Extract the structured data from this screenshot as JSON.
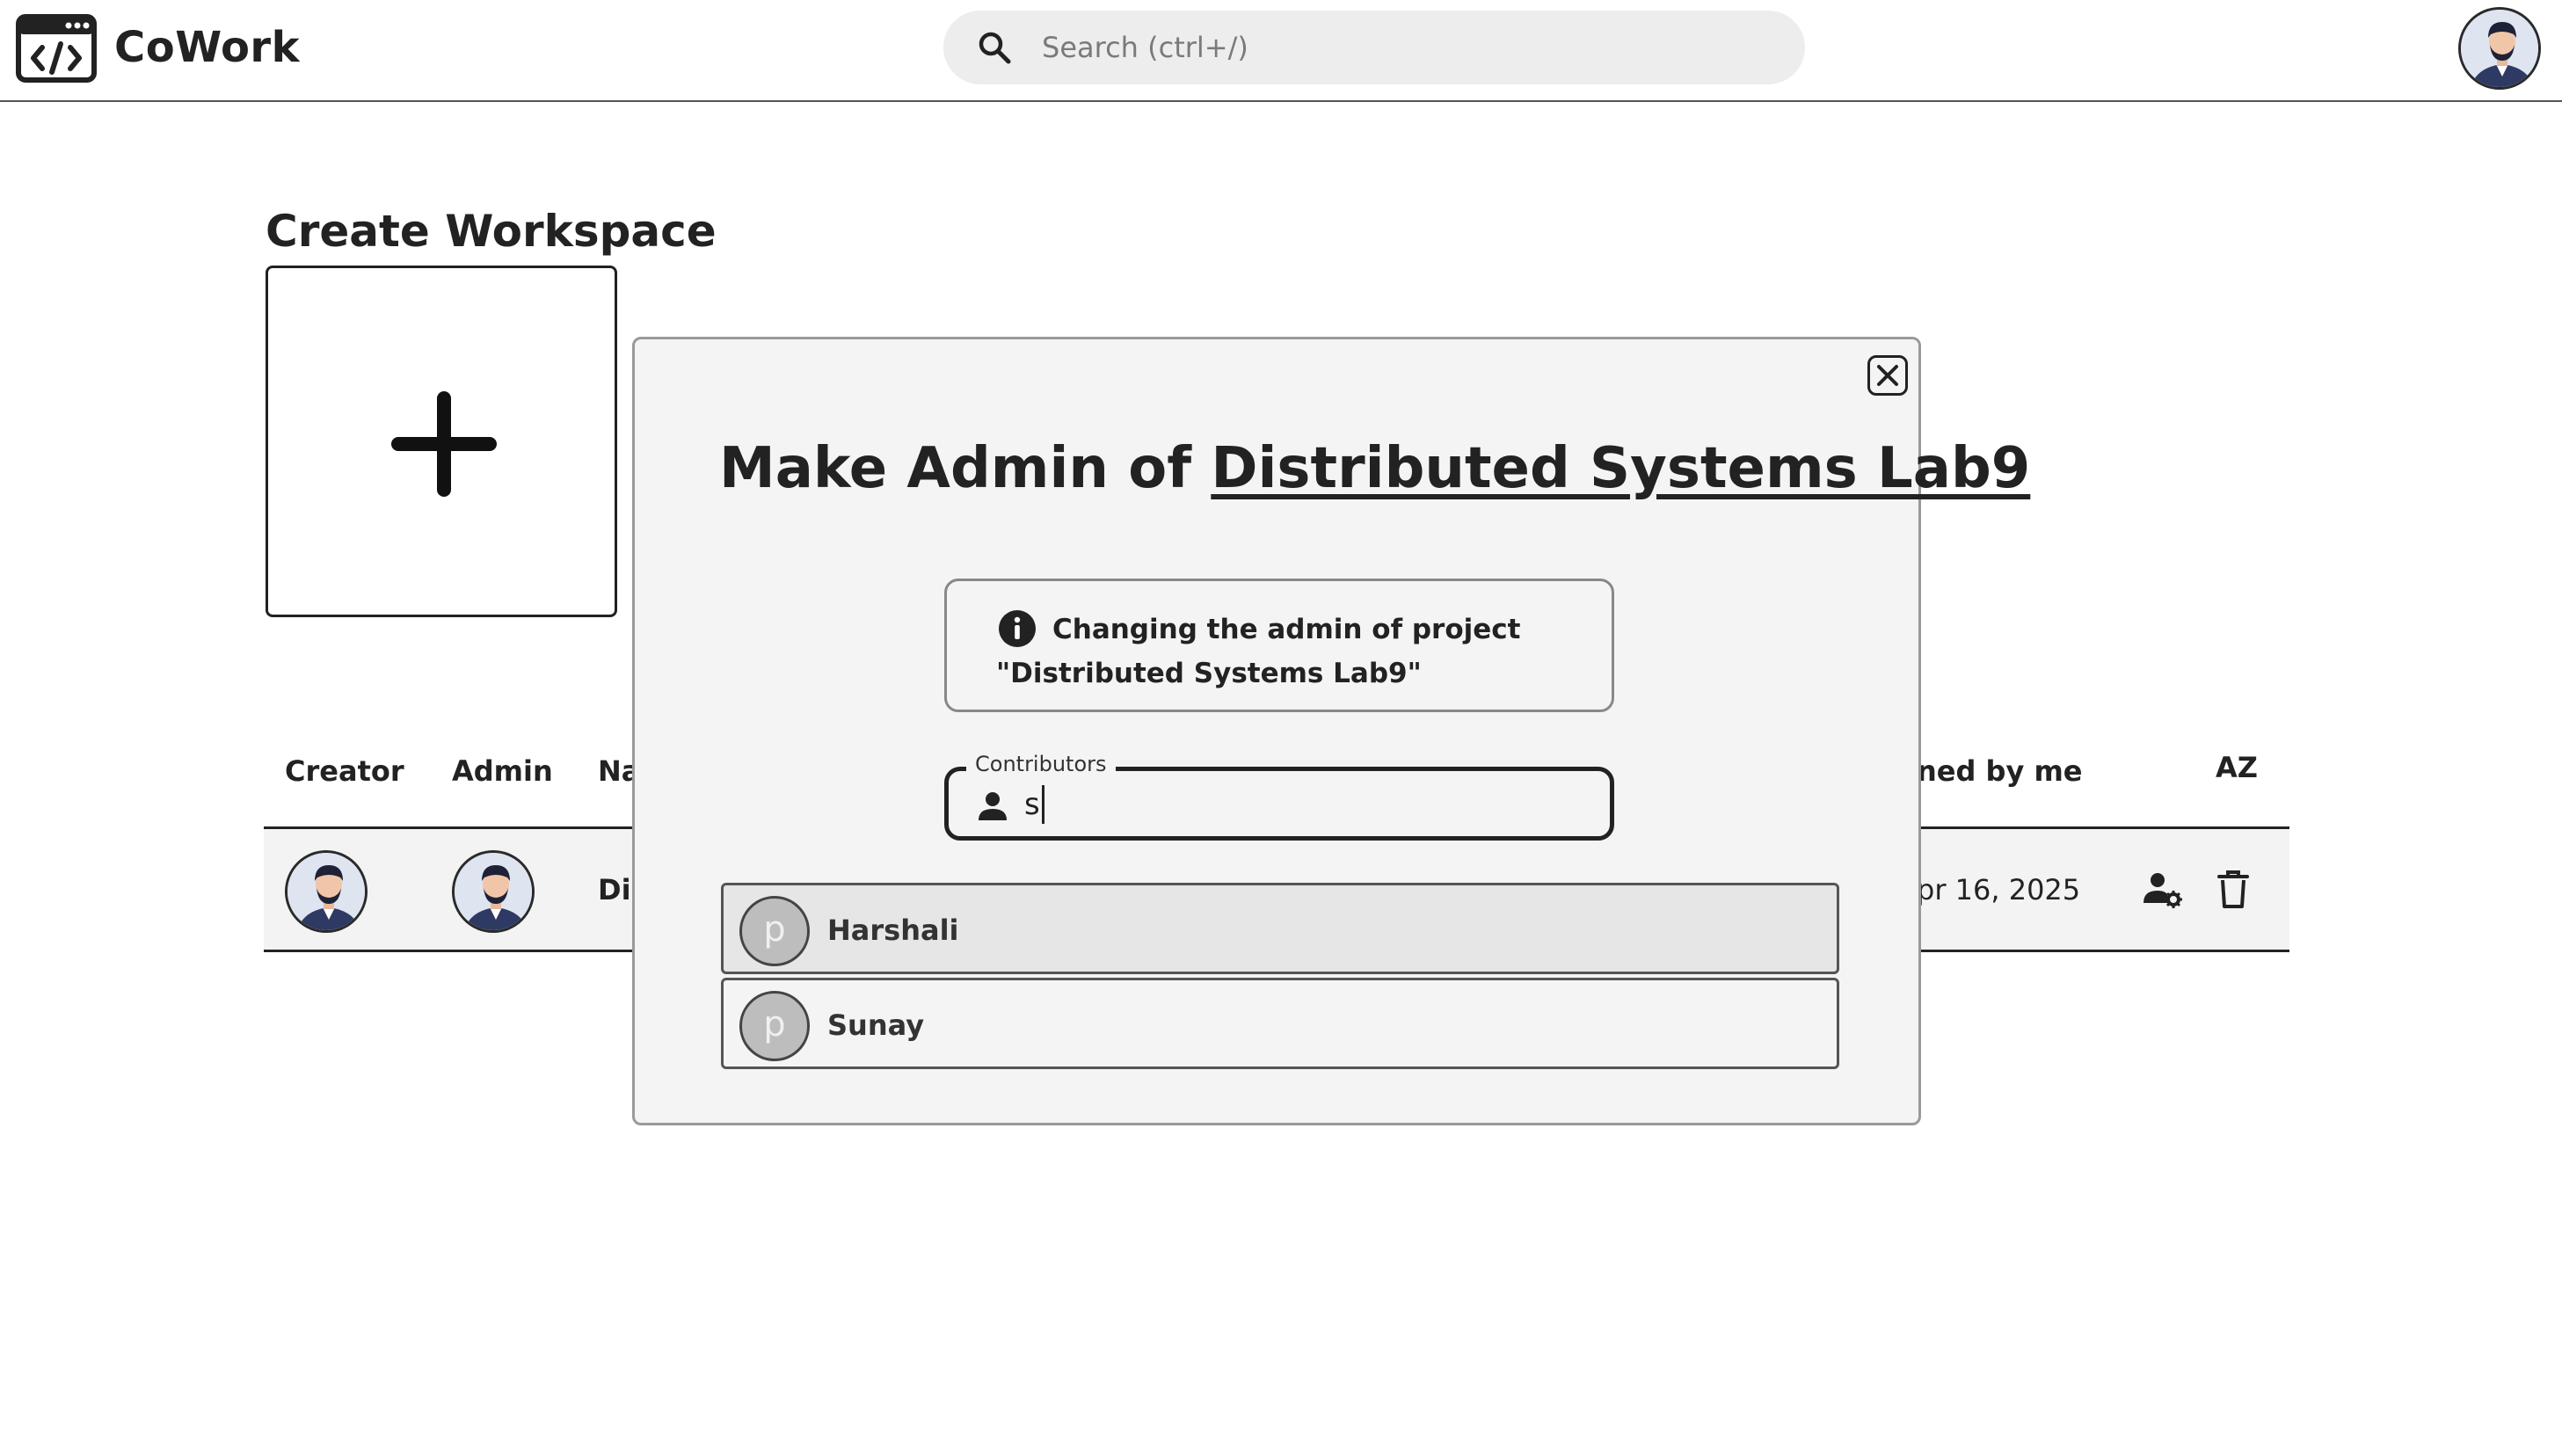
{
  "app": {
    "brand": "CoWork"
  },
  "search": {
    "placeholder": "Search (ctrl+/)"
  },
  "page": {
    "create_title": "Create Workspace"
  },
  "table": {
    "headers": {
      "creator": "Creator",
      "admin": "Admin",
      "name": "Na",
      "owned": "ned by me",
      "sort": "AZ"
    },
    "rows": [
      {
        "name": "Dis",
        "date": "pr 16, 2025"
      }
    ]
  },
  "modal": {
    "title_prefix": "Make Admin of ",
    "title_link": "Distributed Systems Lab9",
    "info_text": "Changing the admin of project \"Distributed Systems Lab9\"",
    "field_label": "Contributors",
    "field_value": "s",
    "options": [
      {
        "initial": "p",
        "name": "Harshali"
      },
      {
        "initial": "p",
        "name": "Sunay"
      }
    ]
  }
}
